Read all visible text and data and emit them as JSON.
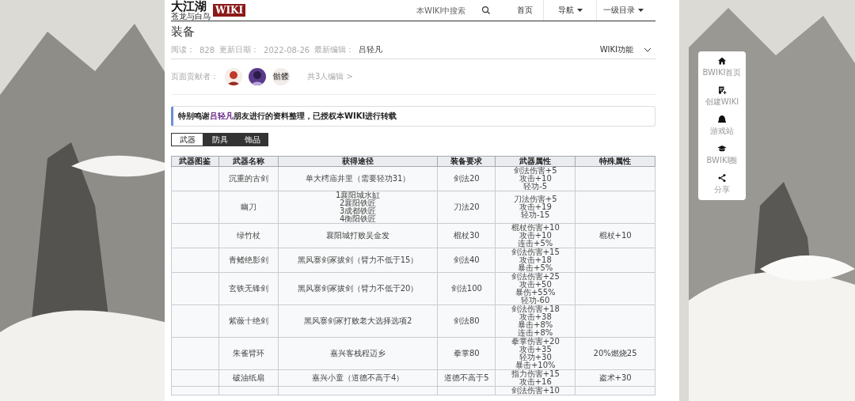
{
  "header": {
    "logo": {
      "title": "大江湖",
      "subtitle": "苍龙与白鸟",
      "badge": "WIKI"
    },
    "search": {
      "placeholder": "本WIKI中搜索"
    },
    "nav": [
      {
        "label": "首页",
        "dropdown": false
      },
      {
        "label": "导航",
        "dropdown": true
      },
      {
        "label": "一级目录",
        "dropdown": true
      }
    ]
  },
  "page": {
    "title": "装备",
    "meta": [
      {
        "label": "阅读：",
        "value": "828"
      },
      {
        "label": "更新日期：",
        "value": "2022-08-26"
      },
      {
        "label": "最新编辑：",
        "value": "吕轻凡"
      }
    ],
    "tools": "WIKI功能"
  },
  "contributors": {
    "label": "页面贡献者：",
    "avatars": [
      {
        "kind": "picture"
      },
      {
        "kind": "picture"
      },
      {
        "kind": "text",
        "text": "骷髅"
      }
    ],
    "count": "共3人编辑 >"
  },
  "notice": {
    "before": "特别鸣谢",
    "link": "吕轻凡",
    "after": "朋友进行的资料整理，已授权本WIKI进行转载"
  },
  "tabs": [
    {
      "label": "武器",
      "selected": true
    },
    {
      "label": "防具",
      "selected": false
    },
    {
      "label": "饰品",
      "selected": false
    }
  ],
  "table": {
    "columns": [
      "武器图鉴",
      "武器名称",
      "获得途径",
      "装备要求",
      "武器属性",
      "特殊属性"
    ],
    "rows": [
      {
        "name": "沉重的古剑",
        "source": [
          "单大樗庙井里（需要轻功31）"
        ],
        "requirement": "剑法20",
        "attributes": [
          "剑法伤害+5",
          "攻击+10",
          "轻功-5"
        ],
        "special": ""
      },
      {
        "name": "幽刀",
        "source": [
          "1襄阳城水缸",
          "2襄阳铁匠",
          "3成都铁匠",
          "4衡阳铁匠"
        ],
        "requirement": "刀法20",
        "attributes": [
          "刀法伤害+5",
          "攻击+19",
          "轻功-15"
        ],
        "special": ""
      },
      {
        "name": "绿竹杖",
        "source": [
          "襄阳城打败吴金发"
        ],
        "requirement": "棍杖30",
        "attributes": [
          "棍杖伤害+10",
          "攻击+10",
          "连击+5%"
        ],
        "special": "棍杖+10"
      },
      {
        "name": "青鳍绝影剑",
        "source": [
          "黑风寨剑冢拔剑（臂力不低于15）"
        ],
        "requirement": "剑法40",
        "attributes": [
          "剑法伤害+15",
          "攻击+18",
          "暴击+5%"
        ],
        "special": ""
      },
      {
        "name": "玄铁无锋剑",
        "source": [
          "黑风寨剑冢拔剑（臂力不低于20）"
        ],
        "requirement": "剑法100",
        "attributes": [
          "剑法伤害+25",
          "攻击+50",
          "暴伤+55%",
          "轻功-60"
        ],
        "special": ""
      },
      {
        "name": "紫薇十绝剑",
        "source": [
          "黑风寨剑冢打败老大选择选项2"
        ],
        "requirement": "剑法80",
        "attributes": [
          "剑法伤害+18",
          "攻击+38",
          "暴击+8%",
          "连击+8%"
        ],
        "special": ""
      },
      {
        "name": "朱雀臂环",
        "source": [
          "嘉兴客栈程迈乡"
        ],
        "requirement": "拳掌80",
        "attributes": [
          "拳掌伤害+20",
          "攻击+35",
          "轻功+30",
          "暴击+10%"
        ],
        "special": "20%燃烧25"
      },
      {
        "name": "破油纸扇",
        "source": [
          "嘉兴小童（道德不高于4）"
        ],
        "requirement": "道德不高于5",
        "attributes": [
          "指力伤害+15",
          "攻击+16"
        ],
        "special": "盗术+30"
      },
      {
        "name": "",
        "source": [],
        "requirement": "",
        "attributes": [
          "剑法伤害+10"
        ],
        "special": ""
      }
    ]
  },
  "float_menu": [
    {
      "label": "BWIKI首页"
    },
    {
      "label": "创建WIKI"
    },
    {
      "label": "游戏站"
    },
    {
      "label": "BWIKI圈"
    },
    {
      "label": "分享"
    }
  ]
}
